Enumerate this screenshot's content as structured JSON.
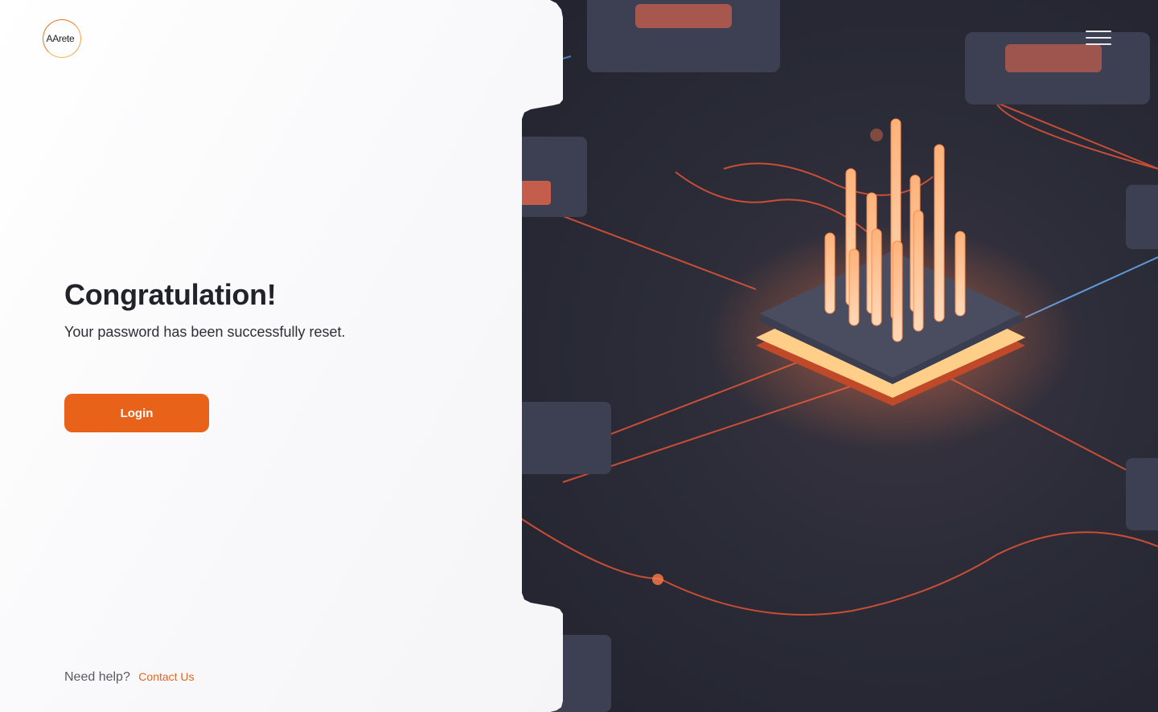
{
  "brand": {
    "logo_text": "AArete"
  },
  "content": {
    "title": "Congratulation!",
    "subtitle": "Your password has been successfully reset.",
    "login_label": "Login"
  },
  "footer": {
    "help_text": "Need help?",
    "contact_label": "Contact Us"
  },
  "colors": {
    "accent": "#e9621a",
    "link": "#e2661e",
    "hero_dark": "#2b2c38",
    "glow": "#ff6a3d"
  },
  "icons": {
    "menu": "hamburger-menu-icon"
  }
}
